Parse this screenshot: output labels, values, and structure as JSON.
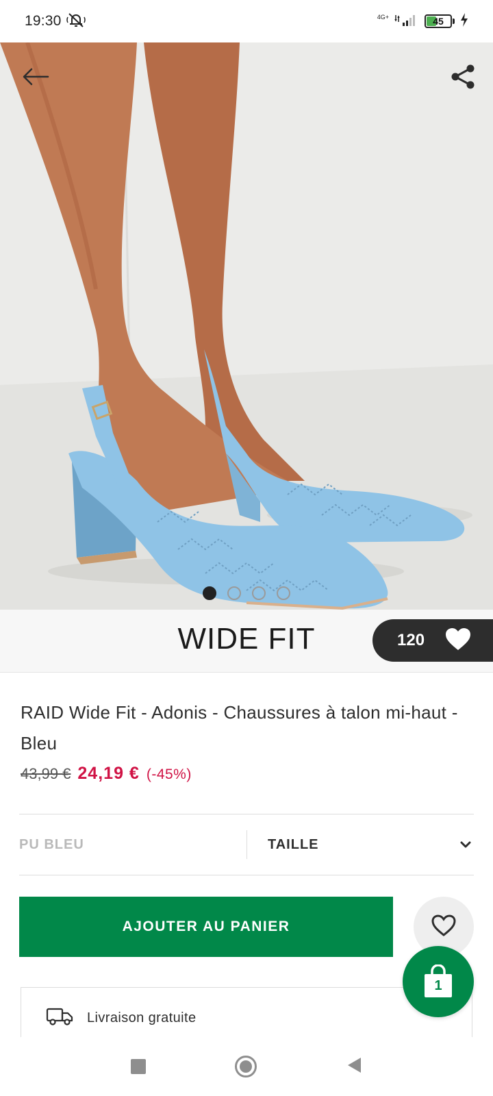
{
  "status_bar": {
    "time": "19:30",
    "network": "4G+",
    "battery": "45",
    "battery_level_percent": 45,
    "icons": [
      "muted-notifications-icon",
      "signal-icon",
      "battery-icon",
      "charging-icon"
    ]
  },
  "gallery": {
    "image_count": 4,
    "active_index": 0,
    "icons": [
      "back-arrow-icon",
      "share-icon"
    ]
  },
  "brand": {
    "name": "WIDE FIT",
    "likes": "120"
  },
  "product": {
    "title": "RAID Wide Fit - Adonis - Chaussures à talon mi-haut - Bleu",
    "price_old": "43,99 €",
    "price_new": "24,19 €",
    "discount": "(-45%)"
  },
  "options": {
    "colour": "PU BLEU",
    "size_label": "TAILLE"
  },
  "actions": {
    "add_to_bag": "AJOUTER AU PANIER",
    "bag_count": "1"
  },
  "delivery": {
    "text": "Livraison gratuite"
  },
  "colors": {
    "accent_green": "#018849",
    "sale_red": "#d01345",
    "dark": "#2d2d2d",
    "shoe_blue": "#8fc3e6"
  }
}
